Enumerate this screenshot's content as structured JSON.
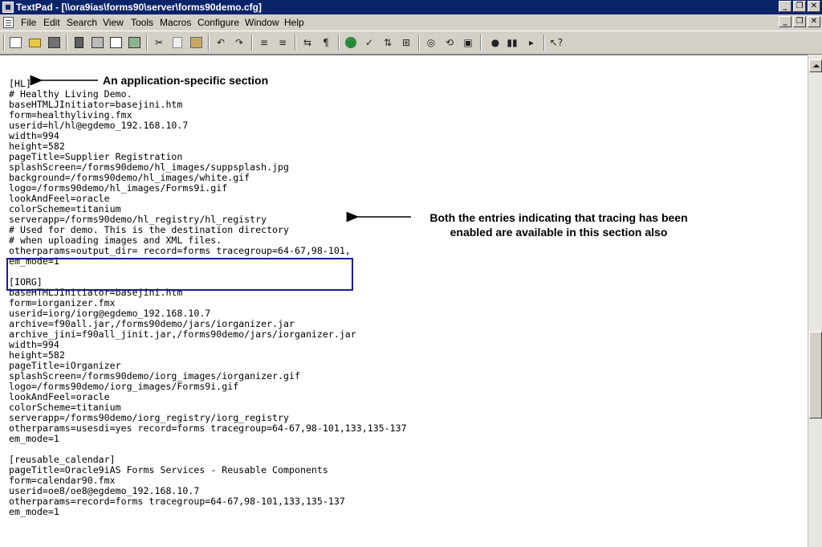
{
  "window": {
    "title": "TextPad - [\\\\ora9ias\\forms90\\server\\forms90demo.cfg]"
  },
  "menu": {
    "items": [
      "File",
      "Edit",
      "Search",
      "View",
      "Tools",
      "Macros",
      "Configure",
      "Window",
      "Help"
    ]
  },
  "toolbar": {
    "icons": [
      "new-file-icon",
      "open-folder-icon",
      "save-icon",
      "save-all-icon",
      "print-icon",
      "print-preview-icon",
      "spell-icon",
      "cut-icon",
      "copy-icon",
      "paste-icon",
      "undo-icon",
      "redo-icon",
      "indent-icon",
      "outdent-icon",
      "word-wrap-icon",
      "paragraph-icon",
      "browser-icon",
      "spell-check-icon",
      "sort-icon",
      "compare-icon",
      "find-icon",
      "replace-icon",
      "find-in-files-icon",
      "record-macro-icon",
      "play-macro-icon",
      "step-icon",
      "context-help-icon"
    ]
  },
  "editor": {
    "lines": [
      "[HL]",
      "# Healthy Living Demo.",
      "baseHTMLJInitiator=basejini.htm",
      "form=healthyliving.fmx",
      "userid=hl/hl@egdemo_192.168.10.7",
      "width=994",
      "height=582",
      "pageTitle=Supplier Registration",
      "splashScreen=/forms90demo/hl_images/suppsplash.jpg",
      "background=/forms90demo/hl_images/white.gif",
      "logo=/forms90demo/hl_images/Forms9i.gif",
      "lookAndFeel=oracle",
      "colorScheme=titanium",
      "serverapp=/forms90demo/hl_registry/hl_registry",
      "# Used for demo. This is the destination directory",
      "# when uploading images and XML files.",
      "otherparams=output_dir= record=forms tracegroup=64-67,98-101,",
      "em_mode=1",
      "",
      "[IORG]",
      "baseHTMLJInitiator=basejini.htm",
      "form=iorganizer.fmx",
      "userid=iorg/iorg@egdemo_192.168.10.7",
      "archive=f90all.jar,/forms90demo/jars/iorganizer.jar",
      "archive_jini=f90all_jinit.jar,/forms90demo/jars/iorganizer.jar",
      "width=994",
      "height=582",
      "pageTitle=iOrganizer",
      "splashScreen=/forms90demo/iorg_images/iorganizer.gif",
      "logo=/forms90demo/iorg_images/Forms9i.gif",
      "lookAndFeel=oracle",
      "colorScheme=titanium",
      "serverapp=/forms90demo/iorg_registry/iorg_registry",
      "otherparams=usesdi=yes record=forms tracegroup=64-67,98-101,133,135-137",
      "em_mode=1",
      "",
      "[reusable_calendar]",
      "pageTitle=Oracle9iAS Forms Services - Reusable Components",
      "form=calendar90.fmx",
      "userid=oe8/oe8@egdemo_192.168.10.7",
      "otherparams=record=forms tracegroup=64-67,98-101,133,135-137",
      "em_mode=1"
    ]
  },
  "annotations": {
    "section_note": "An application-specific section",
    "tracing_note_line1": "Both the entries indicating that tracing has been",
    "tracing_note_line2": "enabled are available in this section also"
  },
  "colors": {
    "titlebar": "#0a246a",
    "highlight_box": "#1a1a9a"
  }
}
